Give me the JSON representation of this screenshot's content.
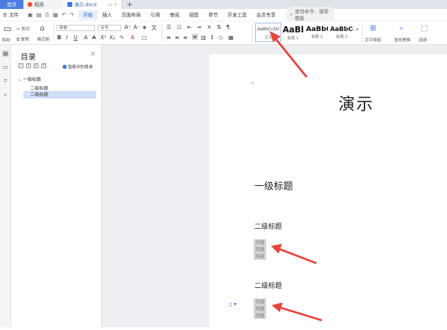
{
  "tabs": {
    "home": "首页",
    "find": "稻壳",
    "doc": "演示.docx",
    "plus": "+"
  },
  "menu": {
    "file": "文件",
    "items": [
      "开始",
      "插入",
      "页面布局",
      "引用",
      "审阅",
      "视图",
      "章节",
      "开发工具",
      "会员专享"
    ],
    "search_placeholder": "查找命令、搜索模板"
  },
  "ribbon": {
    "cut": "剪切",
    "paste": "粘贴",
    "copy": "复制",
    "format_painter": "格式刷",
    "font_name": "宋体",
    "font_size": "五号",
    "styles": [
      {
        "sample": "AaBbCcDd",
        "label": "正文"
      },
      {
        "sample": "AaBb",
        "label": "标题 1"
      },
      {
        "sample": "AaBbC",
        "label": "标题 2"
      },
      {
        "sample": "AaBbCc",
        "label": "标题 3"
      }
    ],
    "text_layout": "文字排版",
    "find_replace": "查找替换",
    "select": "选择"
  },
  "nav": {
    "title": "目录",
    "smart_toc": "智能识别目录",
    "items": [
      {
        "label": "一级标题"
      },
      {
        "label": "二级标题"
      },
      {
        "label": "二级标题"
      }
    ]
  },
  "document": {
    "title": "演示",
    "heading1": "一级标题",
    "heading2a": "二级标题",
    "content_a": [
      "内容",
      "内容",
      "内容"
    ],
    "heading2b": "二级标题",
    "content_b": [
      "内容",
      "内容",
      "内容"
    ]
  },
  "colors": {
    "accent": "#3b78e7",
    "arrow": "#e8453c"
  }
}
